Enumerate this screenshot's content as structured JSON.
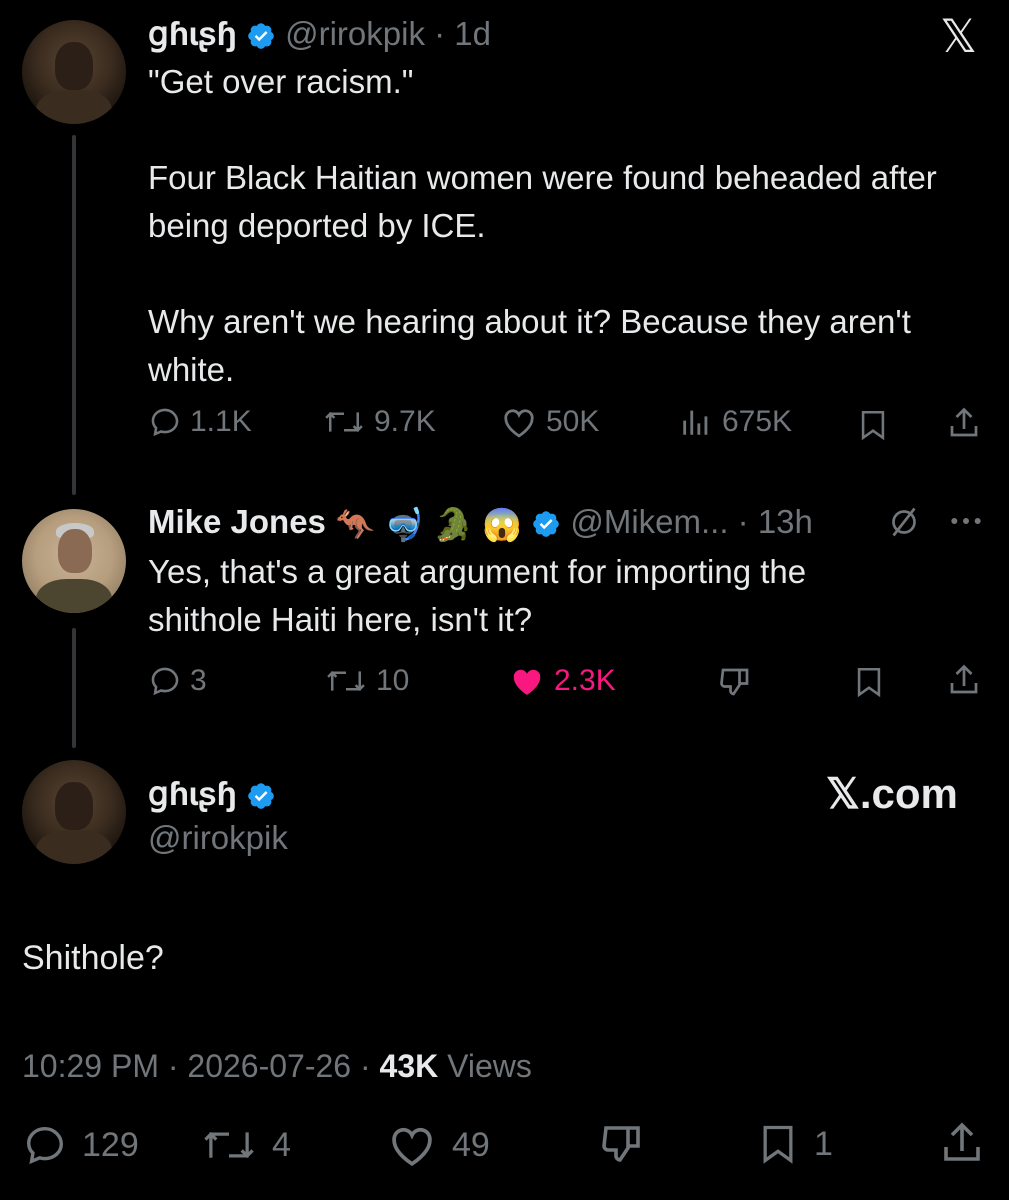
{
  "tweet1": {
    "display_name": "ցɦɩʂɧ",
    "handle_time": "@rirokpik · 1d",
    "text": "\"Get over racism.\"\n\nFour Black Haitian women were found beheaded after being deported by ICE.\n\nWhy aren't we hearing about it? Because they aren't white.",
    "replies": "1.1K",
    "reposts": "9.7K",
    "likes": "50K",
    "views": "675K"
  },
  "tweet2": {
    "display_name": "Mike Jones",
    "emojis": [
      "🦘",
      "🤿",
      "🐊",
      "😱"
    ],
    "handle_time": "@Mikem... · 13h",
    "text": "Yes, that's a great argument for importing the shithole Haiti here, isn't it?",
    "replies": "3",
    "reposts": "10",
    "likes": "2.3K"
  },
  "tweet3": {
    "display_name": "ցɦɩʂɧ",
    "handle": "@rirokpik",
    "text": "Shithole?",
    "time": "10:29 PM",
    "date": "2026-07-26",
    "views_count": "43K",
    "views_label": "Views",
    "replies": "129",
    "reposts": "4",
    "likes": "49",
    "bookmarks": "1"
  },
  "branding": {
    "x_logo": "𝕏",
    "watermark": "𝕏.com"
  },
  "colors": {
    "background": "#000000",
    "text": "#e7e9ea",
    "muted": "#71767b",
    "verified": "#1d9bf0",
    "liked": "#f91880"
  },
  "icons": [
    "reply-icon",
    "repost-icon",
    "like-icon",
    "views-icon",
    "bookmark-icon",
    "share-icon",
    "downvote-icon",
    "grok-icon",
    "more-icon",
    "verified-badge-icon",
    "x-logo-icon"
  ]
}
